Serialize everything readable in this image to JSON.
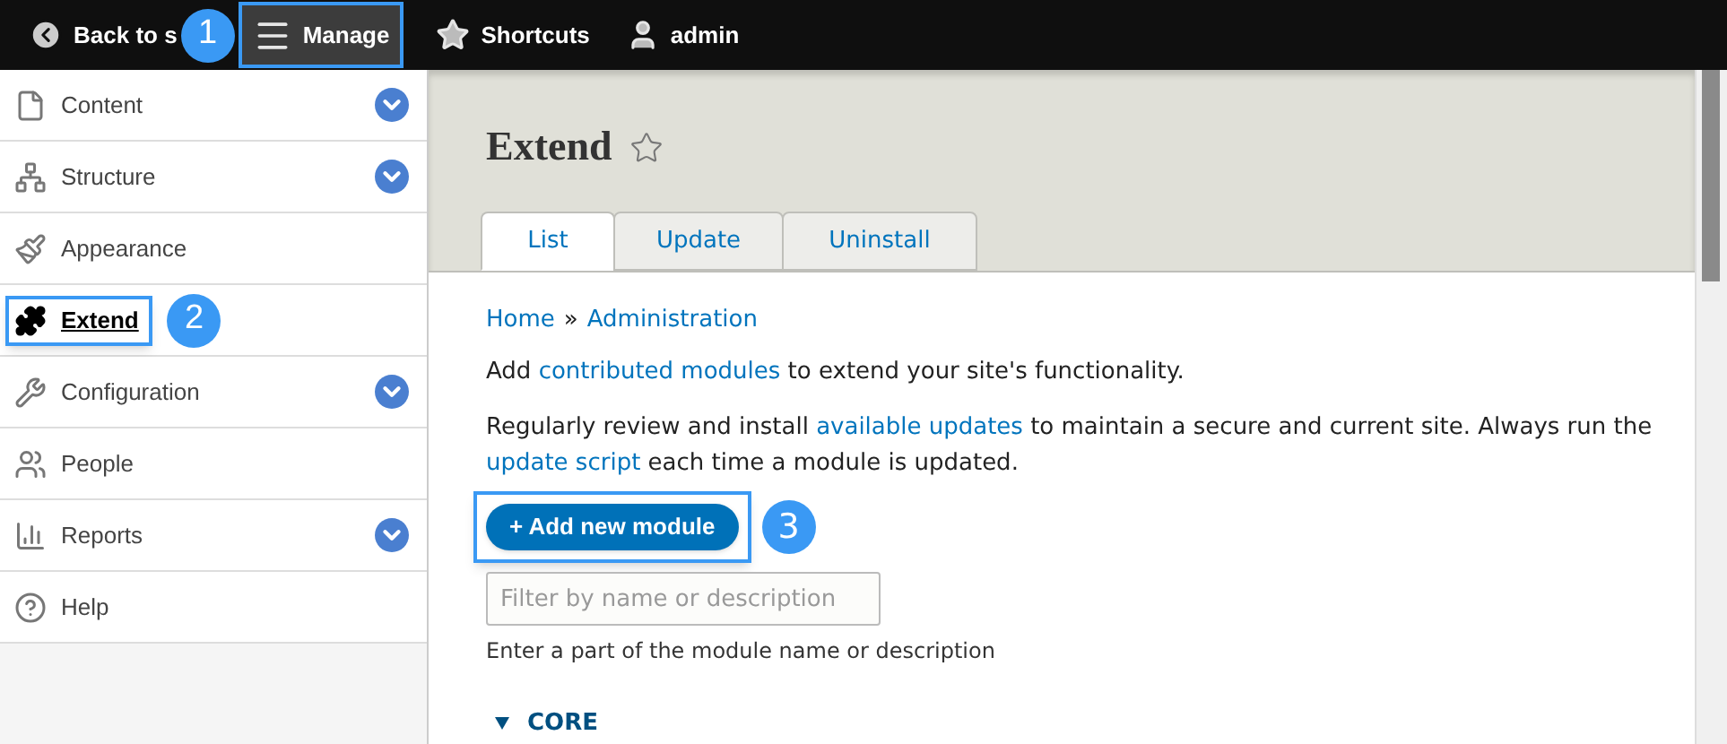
{
  "toolbar": {
    "items": [
      {
        "label": "Back to s",
        "highlighted": false,
        "callout": "1"
      },
      {
        "label": "Manage",
        "highlighted": true
      },
      {
        "label": "Shortcuts",
        "highlighted": false
      },
      {
        "label": "admin",
        "highlighted": false
      }
    ]
  },
  "sidebar": {
    "items": [
      {
        "label": "Content",
        "expandable": true,
        "selected": false,
        "highlighted": false
      },
      {
        "label": "Structure",
        "expandable": true,
        "selected": false,
        "highlighted": false
      },
      {
        "label": "Appearance",
        "expandable": false,
        "selected": false,
        "highlighted": false
      },
      {
        "label": "Extend",
        "expandable": false,
        "selected": true,
        "highlighted": true,
        "callout": "2"
      },
      {
        "label": "Configuration",
        "expandable": true,
        "selected": false,
        "highlighted": false
      },
      {
        "label": "People",
        "expandable": false,
        "selected": false,
        "highlighted": false
      },
      {
        "label": "Reports",
        "expandable": true,
        "selected": false,
        "highlighted": false
      },
      {
        "label": "Help",
        "expandable": false,
        "selected": false,
        "highlighted": false
      }
    ]
  },
  "page": {
    "title": "Extend",
    "tabs": [
      {
        "label": "List",
        "selected": true
      },
      {
        "label": "Update",
        "selected": false
      },
      {
        "label": "Uninstall",
        "selected": false
      }
    ],
    "breadcrumb": [
      "Home",
      "Administration"
    ],
    "breadcrumb_separator": "»",
    "paragraphs": [
      [
        {
          "text": "Add ",
          "link": false
        },
        {
          "text": "contributed modules",
          "link": true
        },
        {
          "text": " to extend your site's functionality.",
          "link": false
        }
      ],
      [
        {
          "text": "Regularly review and install ",
          "link": false
        },
        {
          "text": "available updates",
          "link": true
        },
        {
          "text": " to maintain a secure and current site. Always run the ",
          "link": false
        },
        {
          "text": "update script",
          "link": true
        },
        {
          "text": " each time a module is updated.",
          "link": false
        }
      ]
    ],
    "add_button": {
      "label": "+ Add new module",
      "highlighted": true,
      "callout": "3"
    },
    "filter": {
      "placeholder": "Filter by name or description",
      "hint": "Enter a part of the module name or description"
    },
    "section": {
      "label": "CORE",
      "expanded": true
    }
  }
}
